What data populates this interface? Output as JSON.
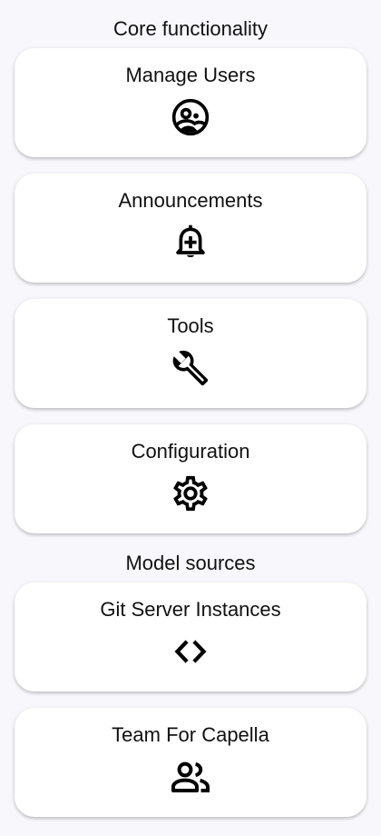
{
  "sections": {
    "core_title": "Core functionality",
    "model_title": "Model sources"
  },
  "cards": [
    {
      "label": "Manage Users",
      "icon": "account-circle-icon"
    },
    {
      "label": "Announcements",
      "icon": "bell-plus-icon"
    },
    {
      "label": "Tools",
      "icon": "wrench-icon"
    },
    {
      "label": "Configuration",
      "icon": "gear-icon"
    },
    {
      "label": "Git Server Instances",
      "icon": "code-brackets-icon"
    },
    {
      "label": "Team For Capella",
      "icon": "people-icon"
    }
  ]
}
